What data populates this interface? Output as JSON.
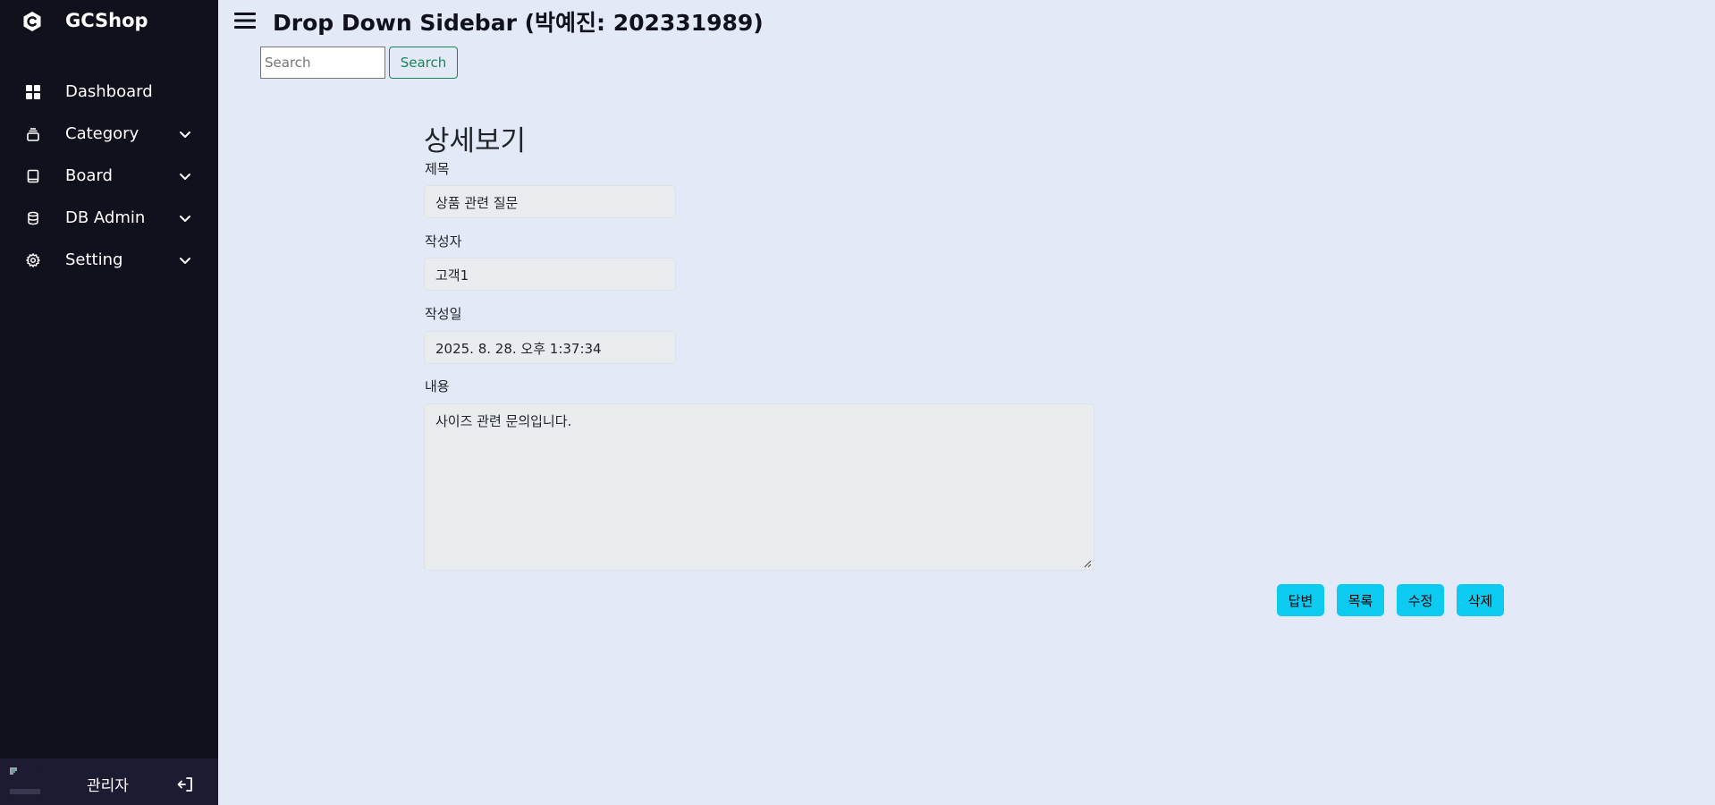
{
  "sidebar": {
    "brand": "GCShop",
    "items": [
      {
        "label": "Dashboard",
        "icon": "dashboard-grid-icon",
        "has_submenu": false
      },
      {
        "label": "Category",
        "icon": "category-layers-icon",
        "has_submenu": true
      },
      {
        "label": "Board",
        "icon": "book-icon",
        "has_submenu": true
      },
      {
        "label": "DB Admin",
        "icon": "database-icon",
        "has_submenu": true
      },
      {
        "label": "Setting",
        "icon": "gear-icon",
        "has_submenu": true
      }
    ],
    "profile": {
      "name": "관리자",
      "logout_icon": "logout-icon"
    }
  },
  "header": {
    "title": "Drop Down Sidebar (박예진: 202331989)"
  },
  "search": {
    "placeholder": "Search",
    "value": "",
    "button_label": "Search"
  },
  "detail": {
    "heading": "상세보기",
    "fields": {
      "title_label": "제목",
      "title_value": "상품 관련 질문",
      "author_label": "작성자",
      "author_value": "고객1",
      "date_label": "작성일",
      "date_value": "2025. 8. 28. 오후 1:37:34",
      "content_label": "내용",
      "content_value": "사이즈 관련 문의입니다."
    },
    "actions": {
      "reply": "답변",
      "list": "목록",
      "edit": "수정",
      "delete": "삭제"
    }
  },
  "colors": {
    "sidebar_bg": "#11101d",
    "profile_bg": "#1d1b31",
    "page_bg": "#e3e9f7",
    "action_button": "#0dcaf0",
    "search_button": "#198754"
  }
}
